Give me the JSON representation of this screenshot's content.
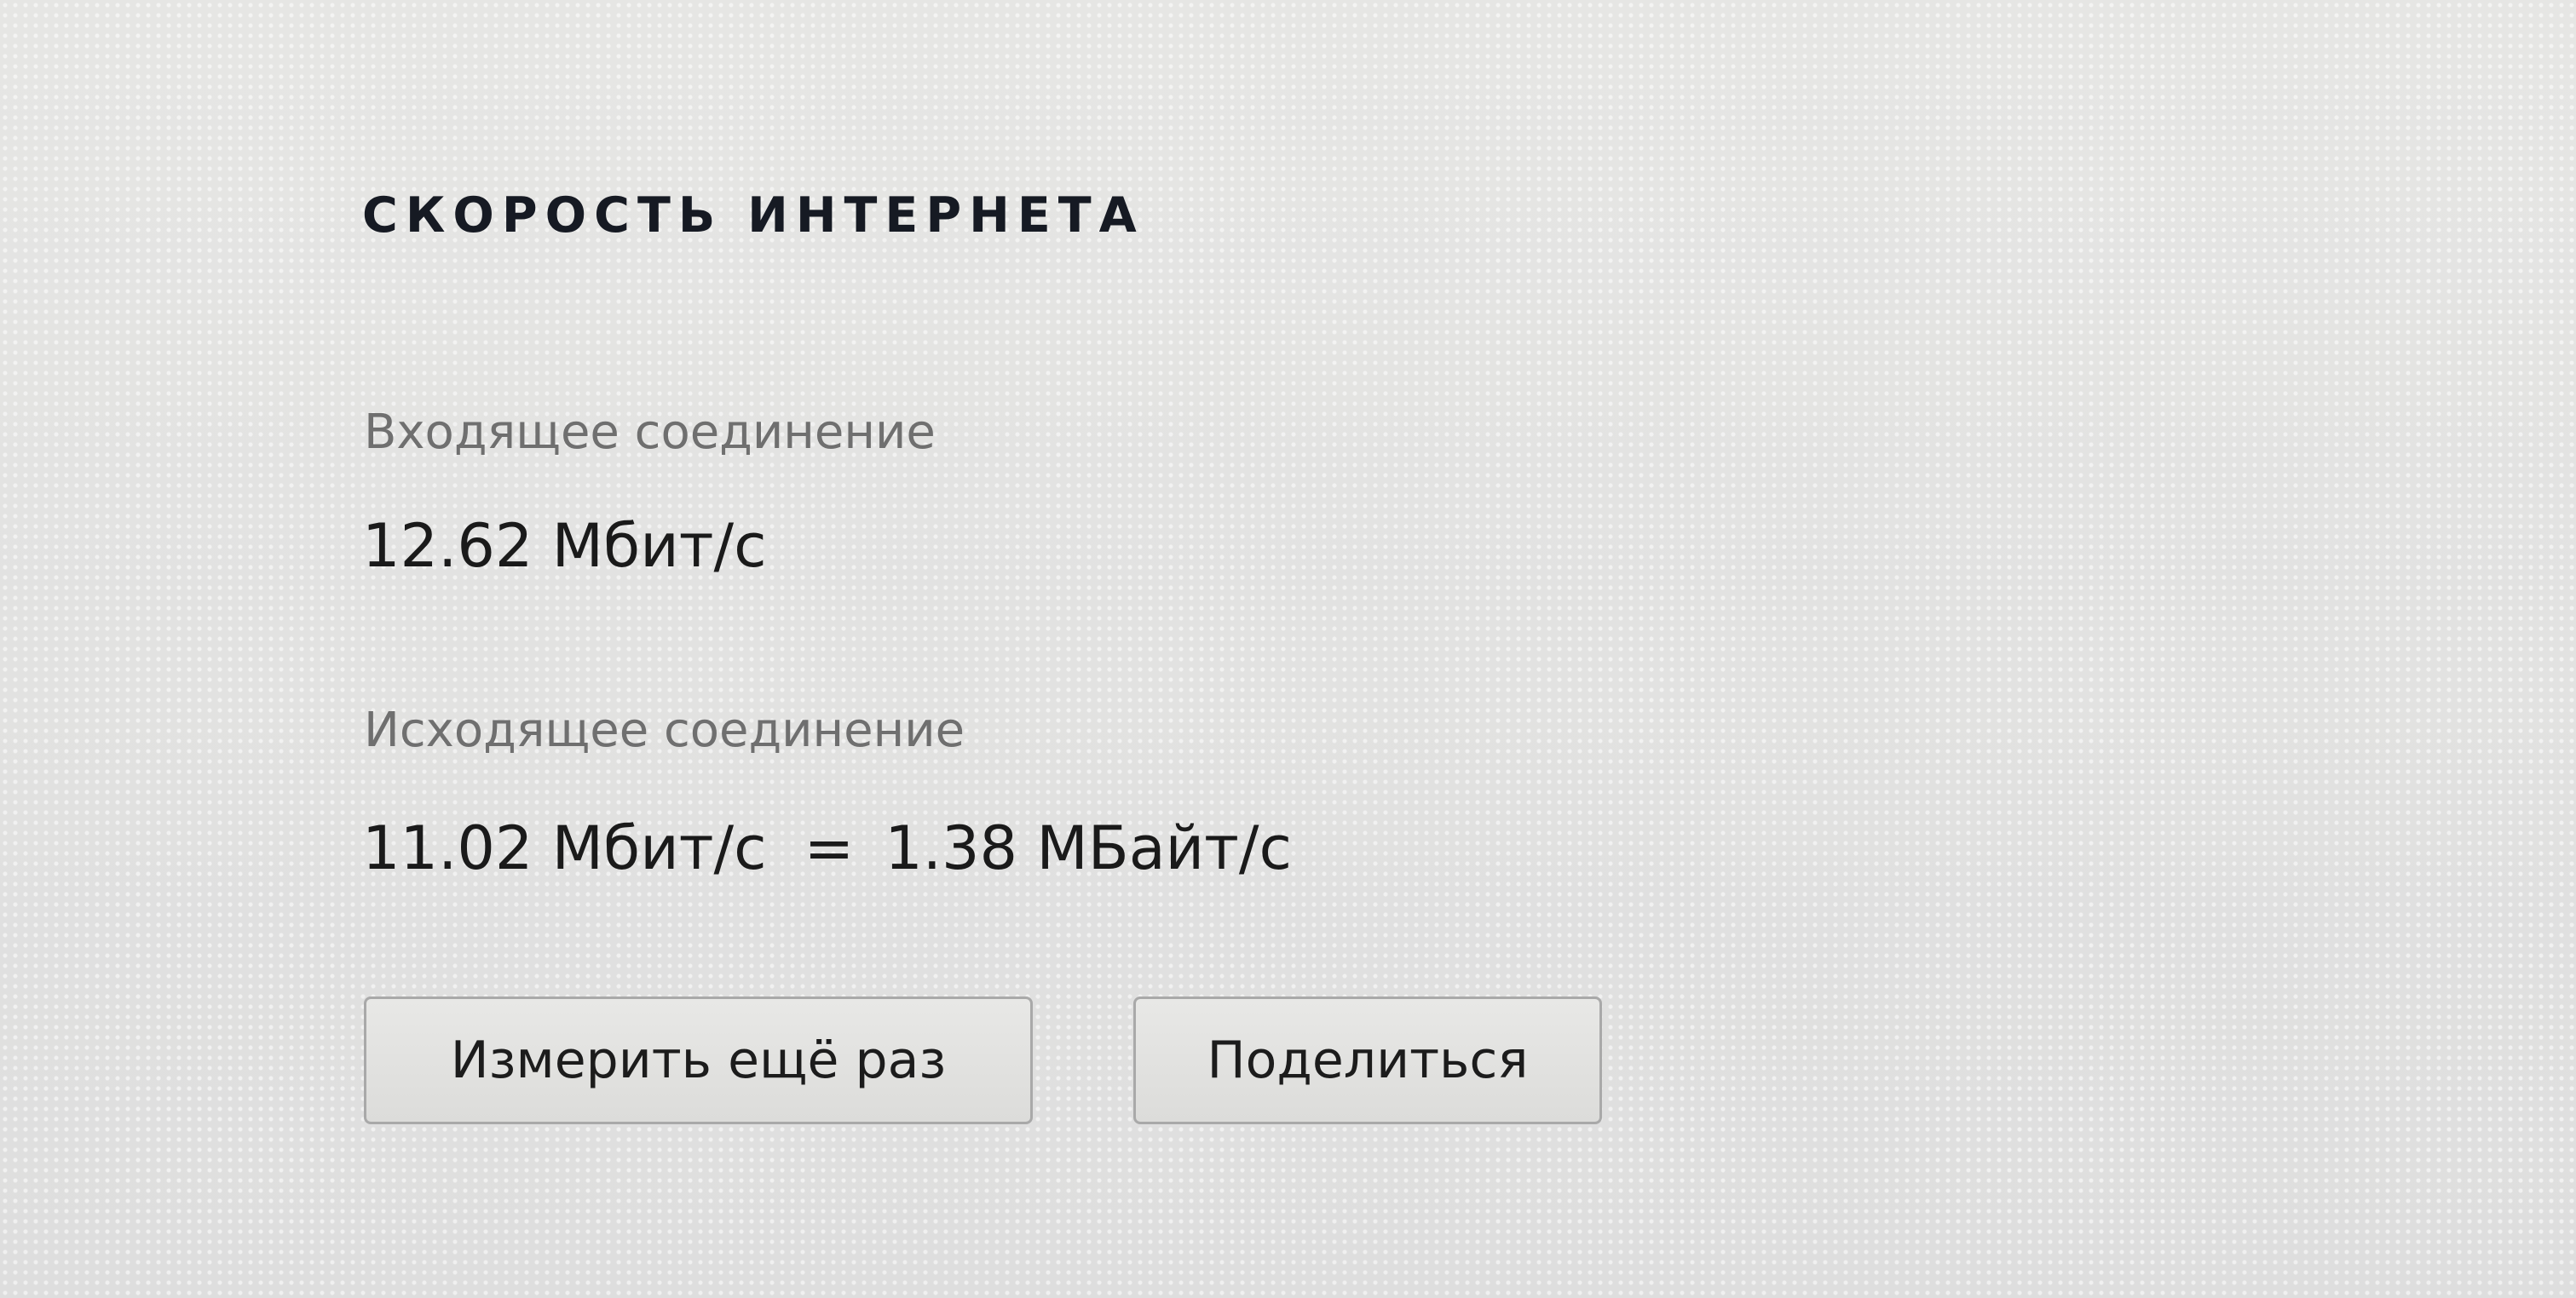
{
  "title": "СКОРОСТЬ ИНТЕРНЕТА",
  "incoming": {
    "label": "Входящее соединение",
    "speed": "12.62 Мбит/с"
  },
  "outgoing": {
    "label": "Исходящее соединение",
    "speed": "11.02 Мбит/с",
    "equals": "=",
    "speed_bytes": "1.38 МБайт/с"
  },
  "buttons": {
    "remeasure": "Измерить ещё раз",
    "share": "Поделиться"
  }
}
